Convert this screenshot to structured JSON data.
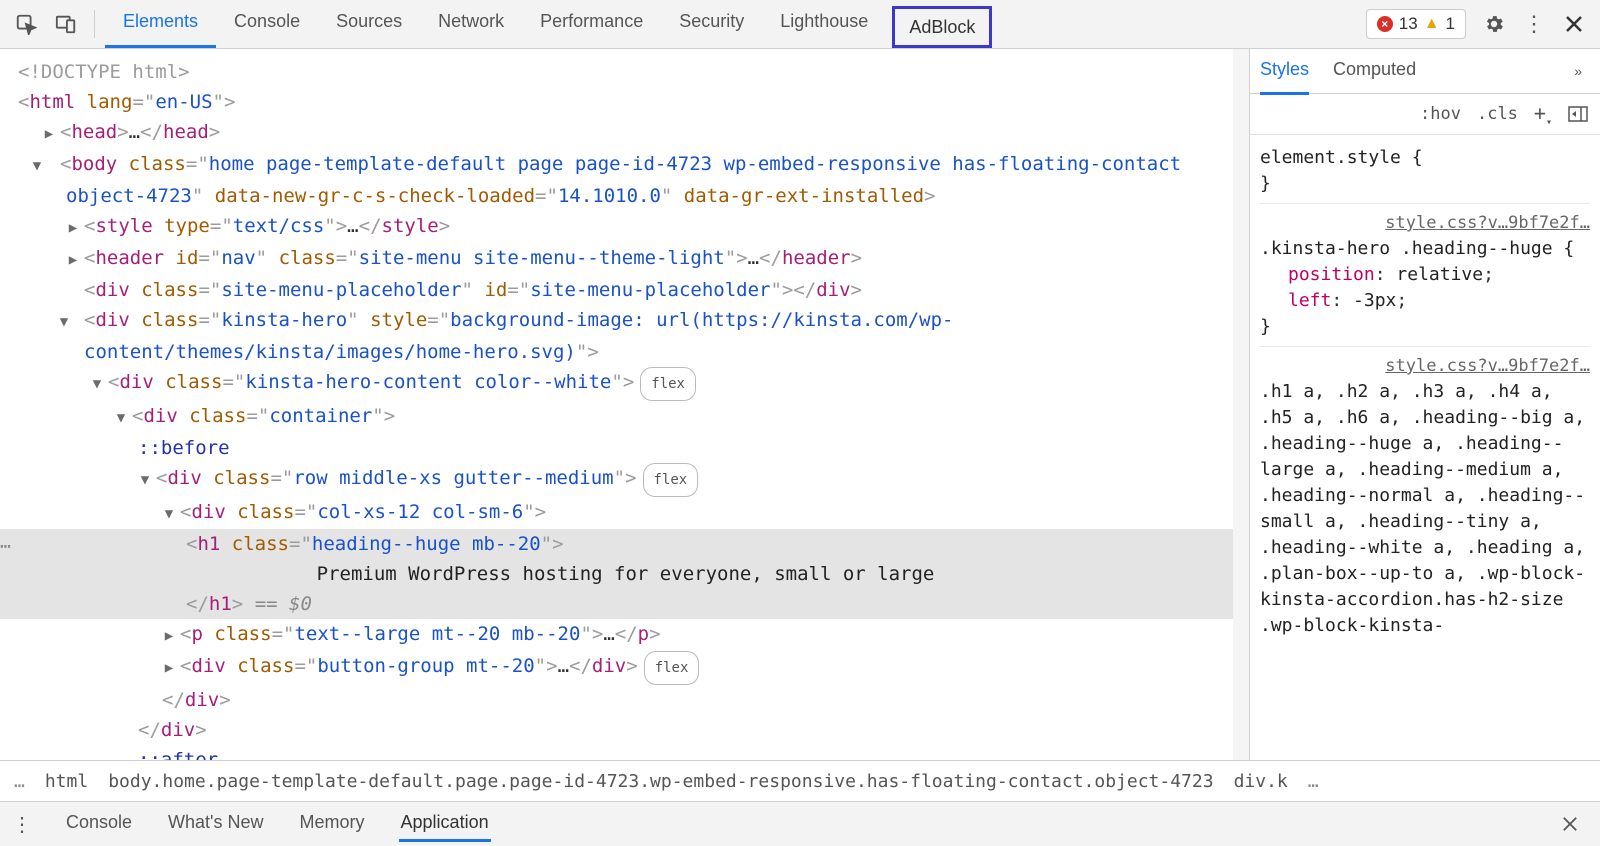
{
  "topbar": {
    "tabs": [
      "Elements",
      "Console",
      "Sources",
      "Network",
      "Performance",
      "Security",
      "Lighthouse"
    ],
    "activeTab": 0,
    "adblock": "AdBlock",
    "errors": "13",
    "warnings": "1"
  },
  "dom": {
    "doctype": "<!DOCTYPE html>",
    "html_open": {
      "tag": "html",
      "attr": "lang",
      "val": "en-US"
    },
    "head": {
      "tag": "head",
      "ell": "…"
    },
    "body": {
      "tag": "body",
      "class": "home page-template-default page page-id-4723 wp-embed-responsive has-floating-contact object-4723",
      "dataAttr1": "data-new-gr-c-s-check-loaded",
      "dataVal1": "14.1010.0",
      "dataAttr2": "data-gr-ext-installed"
    },
    "style": {
      "tag": "style",
      "attr": "type",
      "val": "text/css",
      "ell": "…"
    },
    "header": {
      "tag": "header",
      "idAttr": "id",
      "idVal": "nav",
      "clsAttr": "class",
      "clsVal": "site-menu site-menu--theme-light",
      "ell": "…"
    },
    "placeholder": {
      "tag": "div",
      "clsAttr": "class",
      "clsVal": "site-menu-placeholder",
      "idAttr": "id",
      "idVal": "site-menu-placeholder"
    },
    "hero": {
      "tag": "div",
      "clsAttr": "class",
      "clsVal": "kinsta-hero",
      "styAttr": "style",
      "styVal": "background-image: url(https://kinsta.com/wp-content/themes/kinsta/images/home-hero.svg)"
    },
    "heroContent": {
      "tag": "div",
      "cls": "kinsta-hero-content color--white",
      "flex": "flex"
    },
    "container": {
      "tag": "div",
      "cls": "container"
    },
    "before": "::before",
    "rowDiv": {
      "tag": "div",
      "cls": "row middle-xs gutter--medium",
      "flex": "flex"
    },
    "colDiv": {
      "tag": "div",
      "cls": "col-xs-12 col-sm-6"
    },
    "h1": {
      "tag": "h1",
      "cls": "heading--huge mb--20",
      "text": "Premium WordPress hosting for everyone, small or large",
      "eqZero": "== $0"
    },
    "p": {
      "tag": "p",
      "cls": "text--large mt--20 mb--20",
      "ell": "…"
    },
    "btnGroup": {
      "tag": "div",
      "cls": "button-group mt--20",
      "ell": "…",
      "flex": "flex"
    },
    "closeDiv": "div",
    "after": "::after"
  },
  "crumb": {
    "dots": "…",
    "html": "html",
    "body": "body.home.page-template-default.page.page-id-4723.wp-embed-responsive.has-floating-contact.object-4723",
    "divk": "div.k",
    "trail": "…"
  },
  "drawer": {
    "tabs": [
      "Console",
      "What's New",
      "Memory",
      "Application"
    ],
    "active": 3
  },
  "styles": {
    "tabs": [
      "Styles",
      "Computed"
    ],
    "hov": ":hov",
    "cls": ".cls",
    "elementStyle": "element.style {",
    "brace": "}",
    "src": "style.css?v…9bf7e2f…",
    "rule1": {
      "sel": ".kinsta-hero .heading--huge {",
      "p1": "position",
      "v1": "relative",
      "p2": "left",
      "v2": "-3px"
    },
    "rule2": {
      "sel": ".h1 a, .h2 a, .h3 a, .h4 a, .h5 a, .h6 a, .heading--big a, .heading--huge a, .heading--large a, .heading--medium a, .heading--normal a, .heading--small a, .heading--tiny a, .heading--white a, .heading a, .plan-box--up-to a, .wp-block-kinsta-accordion.has-h2-size .wp-block-kinsta-"
    }
  }
}
